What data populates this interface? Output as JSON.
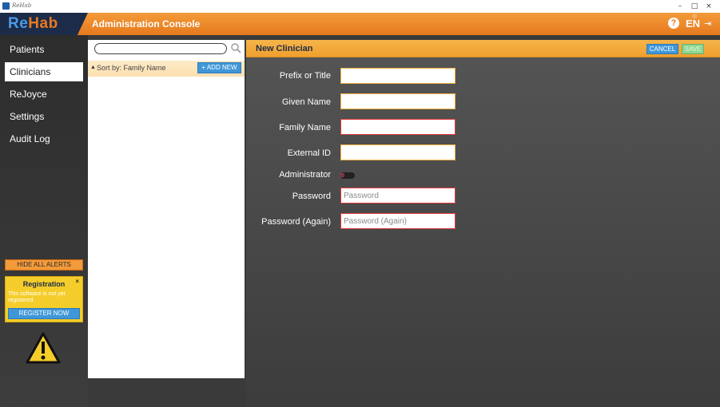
{
  "window": {
    "title": "ReHab",
    "controls": [
      "–",
      "□",
      "×"
    ]
  },
  "header": {
    "logo": {
      "re": "Re",
      "hab": "Hab"
    },
    "title": "Administration Console",
    "language": "EN"
  },
  "sidebar": {
    "items": [
      {
        "label": "Patients",
        "active": false
      },
      {
        "label": "Clinicians",
        "active": true
      },
      {
        "label": "ReJoyce",
        "active": false
      },
      {
        "label": "Settings",
        "active": false
      },
      {
        "label": "Audit Log",
        "active": false
      }
    ],
    "hide_alerts_label": "HIDE ALL ALERTS",
    "registration": {
      "title": "Registration",
      "message": "This software is not yet registered.",
      "button_label": "REGISTER NOW"
    }
  },
  "list": {
    "search_value": "",
    "sort_label": "Sort by:  Family Name",
    "add_new_label": "+ ADD NEW"
  },
  "form": {
    "title": "New Clinician",
    "cancel_label": "CANCEL",
    "save_label": "SAVE",
    "fields": {
      "prefix": {
        "label": "Prefix or Title",
        "value": "",
        "placeholder": ""
      },
      "given": {
        "label": "Given Name",
        "value": "",
        "placeholder": ""
      },
      "family": {
        "label": "Family Name",
        "value": "",
        "placeholder": ""
      },
      "external": {
        "label": "External ID",
        "value": "",
        "placeholder": ""
      },
      "admin": {
        "label": "Administrator",
        "value": false
      },
      "password": {
        "label": "Password",
        "value": "",
        "placeholder": "Password"
      },
      "password_again": {
        "label": "Password (Again)",
        "value": "",
        "placeholder": "Password (Again)"
      }
    }
  },
  "colors": {
    "accent_orange": "#f39a3a",
    "accent_blue": "#3f97d8",
    "logo_navy": "#1b2b48",
    "invalid_border": "#e03a3a",
    "warning_yellow": "#f5cd2a"
  }
}
